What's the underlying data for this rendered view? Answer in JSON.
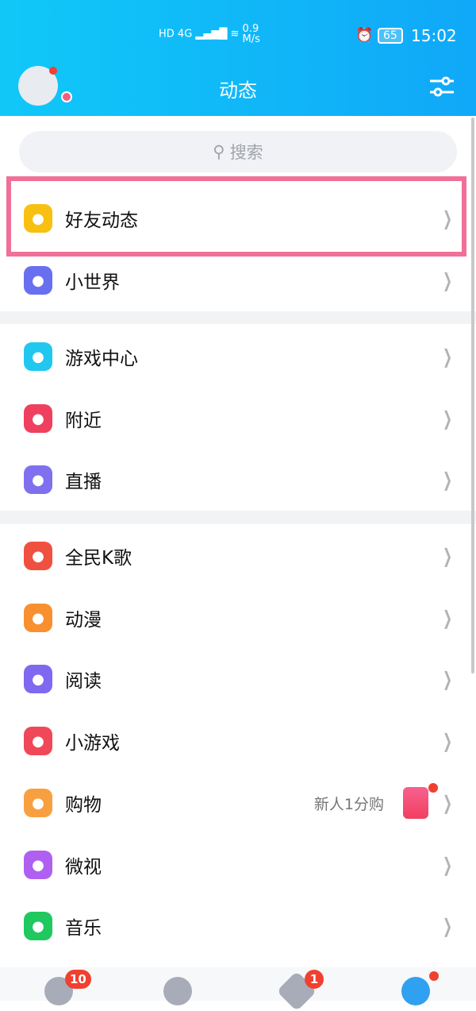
{
  "status": {
    "network": "HD 4G",
    "speed_value": "0.9",
    "speed_unit": "M/s",
    "battery": "65",
    "time": "15:02"
  },
  "header": {
    "title": "动态"
  },
  "search": {
    "placeholder": "搜索"
  },
  "items": [
    {
      "label": "好友动态",
      "icon": "qzone-icon",
      "color": "#f8c010"
    },
    {
      "label": "小世界",
      "icon": "small-world-icon",
      "color": "#6870f0"
    },
    {
      "label": "游戏中心",
      "icon": "gamepad-icon",
      "color": "#20c8f0"
    },
    {
      "label": "附近",
      "icon": "location-pin-icon",
      "color": "#f04060"
    },
    {
      "label": "直播",
      "icon": "live-icon",
      "color": "#8070f0"
    },
    {
      "label": "全民K歌",
      "icon": "karaoke-icon",
      "color": "#f05040"
    },
    {
      "label": "动漫",
      "icon": "anime-icon",
      "color": "#f89030"
    },
    {
      "label": "阅读",
      "icon": "reading-icon",
      "color": "#8068f0"
    },
    {
      "label": "小游戏",
      "icon": "mini-game-icon",
      "color": "#f04858"
    },
    {
      "label": "购物",
      "icon": "shopping-icon",
      "color": "#f8a040",
      "promo": "新人1分购"
    },
    {
      "label": "微视",
      "icon": "weishi-icon",
      "color": "#b060f0"
    },
    {
      "label": "音乐",
      "icon": "music-icon",
      "color": "#20c860"
    }
  ],
  "tabbar": {
    "messages_badge": "10",
    "watch_badge": "1"
  },
  "highlight_color": "#f07098"
}
